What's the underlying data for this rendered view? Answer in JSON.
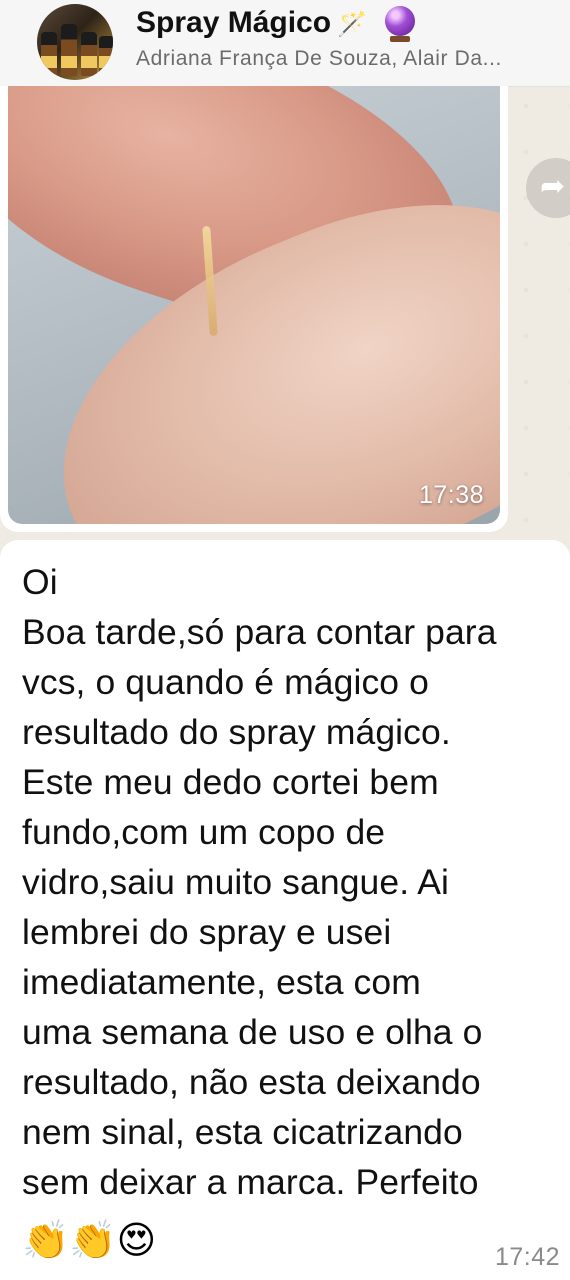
{
  "header": {
    "title": "Spray Mágico",
    "title_wand_icon": "🪄",
    "subtitle": "Adriana França De Souza, Alair Da..."
  },
  "image_message": {
    "time": "17:38"
  },
  "text_message": {
    "lines": [
      "Oi",
      "Boa tarde,só para contar para",
      "vcs, o quando é mágico o",
      "resultado do spray mágico.",
      "Este meu dedo cortei bem",
      "fundo,com um copo de",
      "vidro,saiu muito sangue. Ai",
      "lembrei do spray e usei",
      "imediatamente, esta com",
      "uma semana de uso e olha o",
      "resultado, não esta deixando",
      "nem sinal, esta cicatrizando",
      "sem deixar a marca. Perfeito"
    ],
    "emojis": "👏👏😍",
    "time": "17:42"
  },
  "icons": {
    "forward": "forward-icon",
    "crystal_ball": "crystal-ball-icon"
  }
}
